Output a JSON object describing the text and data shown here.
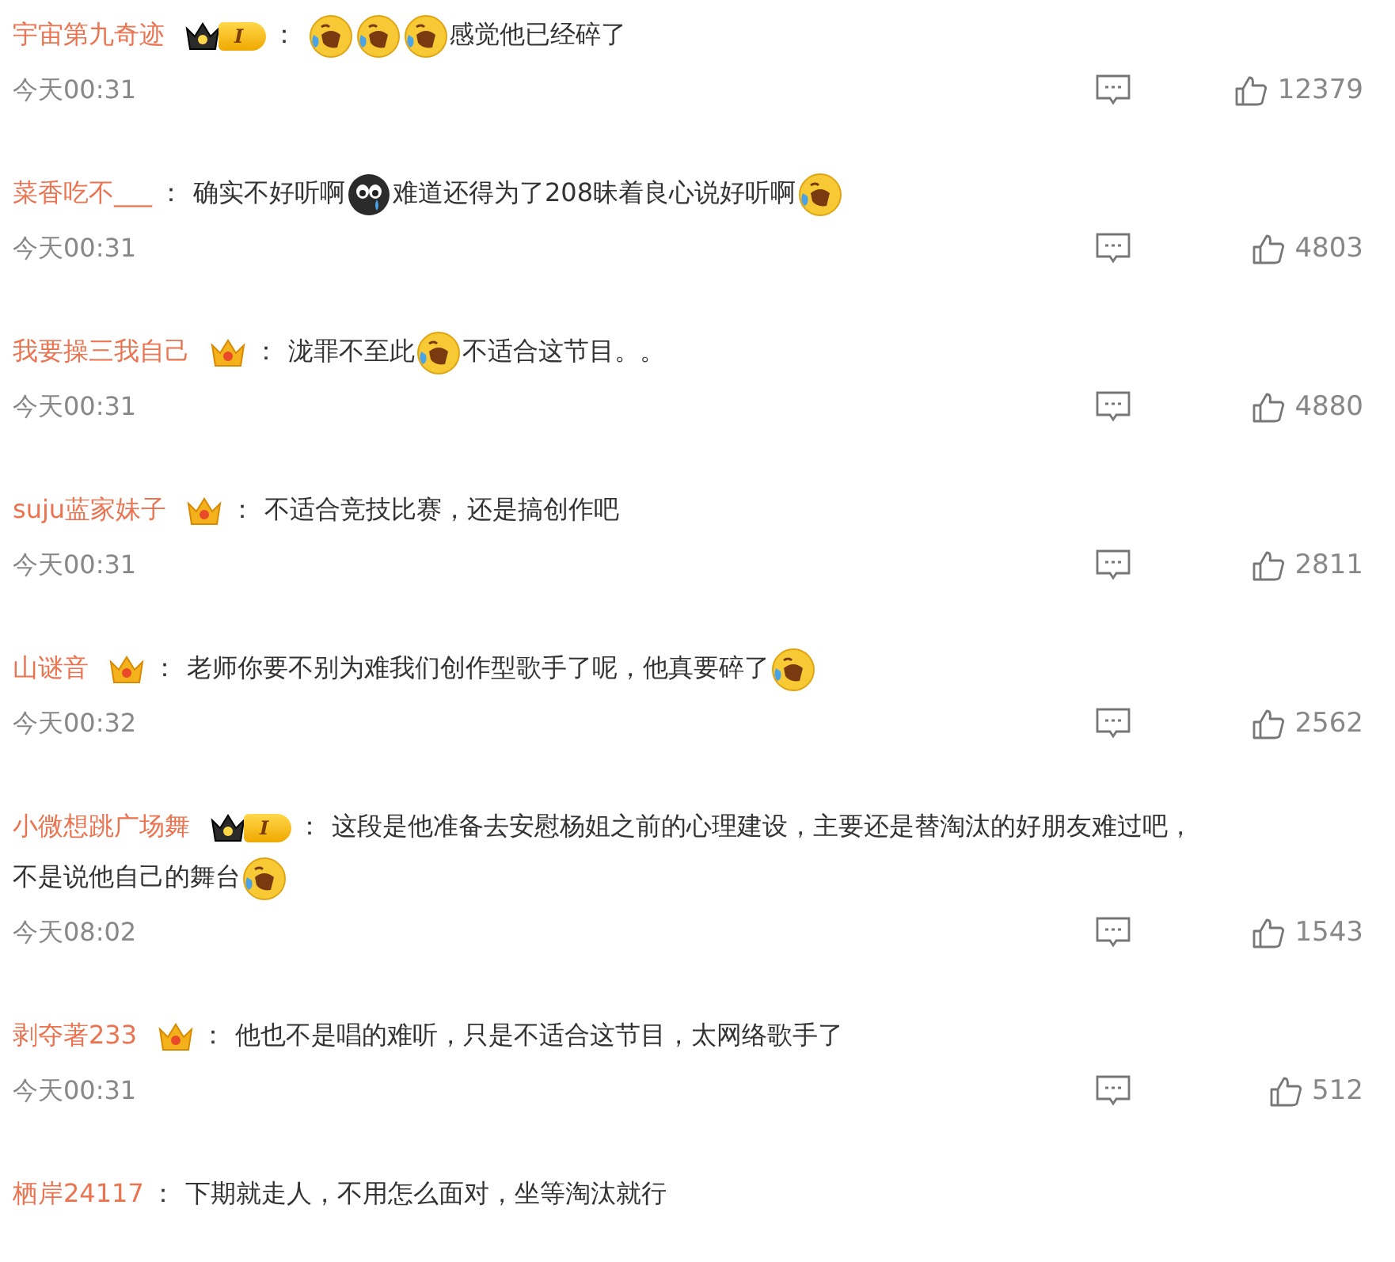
{
  "comments": [
    {
      "username": "宇宙第九奇迹",
      "badge": {
        "kind": "crown-level",
        "level": "I"
      },
      "colon": "：",
      "content": [
        {
          "kind": "laughing-emoji"
        },
        {
          "kind": "laughing-emoji"
        },
        {
          "kind": "laughing-emoji"
        },
        {
          "kind": "text",
          "text": "感觉他已经碎了"
        }
      ],
      "time": "今天00:31",
      "likes": "12379"
    },
    {
      "username": "菜香吃不___",
      "colon": "：",
      "content": [
        {
          "kind": "text",
          "text": "确实不好听啊"
        },
        {
          "kind": "crying-emoji"
        },
        {
          "kind": "text",
          "text": "难道还得为了208昧着良心说好听啊"
        },
        {
          "kind": "laughing-emoji"
        }
      ],
      "time": "今天00:31",
      "likes": "4803"
    },
    {
      "username": "我要操三我自己",
      "badge": {
        "kind": "crown-small"
      },
      "colon": "：",
      "content": [
        {
          "kind": "text",
          "text": "泷罪不至此"
        },
        {
          "kind": "laughing-emoji"
        },
        {
          "kind": "text",
          "text": "不适合这节目。。"
        }
      ],
      "time": "今天00:31",
      "likes": "4880"
    },
    {
      "username": "suju蓝家妹子",
      "badge": {
        "kind": "crown-small"
      },
      "colon": "：",
      "content": [
        {
          "kind": "text",
          "text": "不适合竞技比赛，还是搞创作吧"
        }
      ],
      "time": "今天00:31",
      "likes": "2811"
    },
    {
      "username": "山谜音",
      "badge": {
        "kind": "crown-small"
      },
      "colon": "：",
      "content": [
        {
          "kind": "text",
          "text": "老师你要不别为难我们创作型歌手了呢，他真要碎了"
        },
        {
          "kind": "laughing-emoji"
        }
      ],
      "time": "今天00:32",
      "likes": "2562"
    },
    {
      "username": "小微想跳广场舞",
      "badge": {
        "kind": "crown-level",
        "level": "I"
      },
      "colon": "：",
      "content": [
        {
          "kind": "text",
          "text": "这段是他准备去安慰杨姐之前的心理建设，主要还是替淘汰的好朋友难过吧，"
        },
        {
          "kind": "text",
          "text": "不是说他自己的舞台"
        },
        {
          "kind": "laughing-emoji"
        }
      ],
      "time": "今天08:02",
      "likes": "1543"
    },
    {
      "username": "剥夺著233",
      "badge": {
        "kind": "crown-small"
      },
      "colon": "：",
      "content": [
        {
          "kind": "text",
          "text": "他也不是唱的难听，只是不适合这节目，太网络歌手了"
        }
      ],
      "time": "今天00:31",
      "likes": "512"
    },
    {
      "username": "栖岸24117",
      "colon": "：",
      "content": [
        {
          "kind": "text",
          "text": "下期就走人，不用怎么面对，坐等淘汰就行"
        }
      ]
    }
  ]
}
